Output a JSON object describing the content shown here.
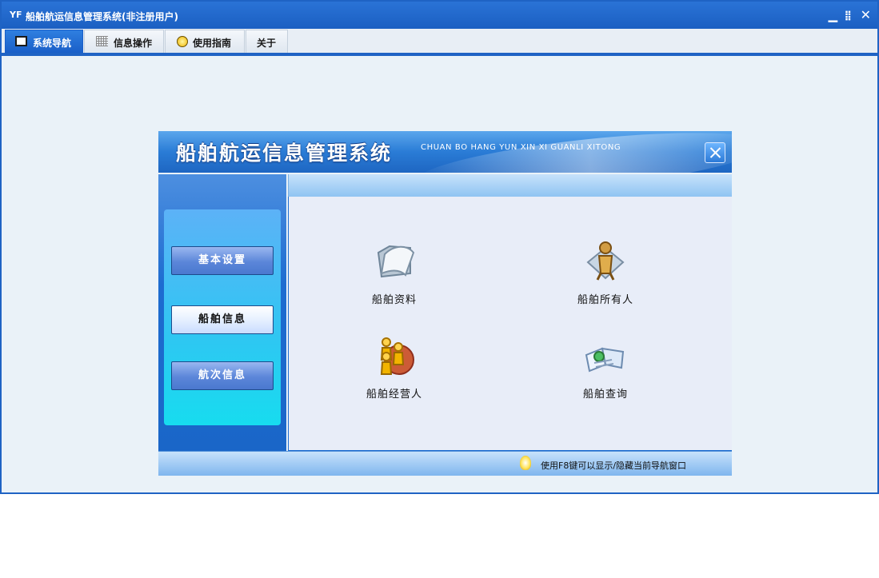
{
  "window": {
    "logo": "YF",
    "title": "船舶航运信息管理系统(非注册用户)"
  },
  "menu": {
    "tabs": [
      {
        "label": "系统导航",
        "icon": "monitor-icon",
        "active": true
      },
      {
        "label": "信息操作",
        "icon": "grid-icon",
        "active": false
      },
      {
        "label": "使用指南",
        "icon": "guide-icon",
        "active": false
      },
      {
        "label": "关于",
        "icon": "",
        "active": false
      }
    ]
  },
  "nav_panel": {
    "title": "船舶航运信息管理系统",
    "subtitle": "CHUAN BO HANG YUN XIN XI GUANLI XITONG",
    "sidebar": [
      {
        "label": "基本设置",
        "active": false
      },
      {
        "label": "船舶信息",
        "active": true
      },
      {
        "label": "航次信息",
        "active": false
      }
    ],
    "items": [
      {
        "label": "船舶资料",
        "icon": "folder-icon"
      },
      {
        "label": "船舶所有人",
        "icon": "person-icon"
      },
      {
        "label": "船舶经营人",
        "icon": "people-globe-icon"
      },
      {
        "label": "船舶查询",
        "icon": "search-book-icon"
      }
    ],
    "footer_tip": "使用F8键可以显示/隐藏当前导航窗口"
  },
  "colors": {
    "accent": "#1f63c4",
    "active_tab": "#1a5fc8",
    "content_bg": "#e8edf8"
  }
}
